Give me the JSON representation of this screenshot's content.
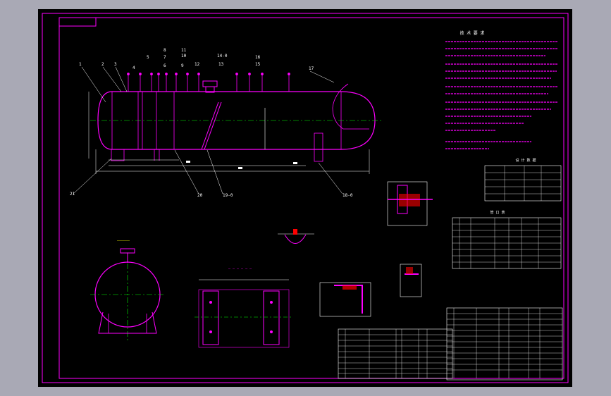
{
  "drawing": {
    "title_block_top_left": "",
    "part_numbers": [
      "1",
      "2",
      "3",
      "4",
      "5",
      "6",
      "7",
      "8",
      "9",
      "10",
      "11",
      "12",
      "13",
      "14-0",
      "15",
      "16",
      "17",
      "18-0",
      "19-0",
      "20",
      "21"
    ]
  },
  "notes": {
    "heading": "技 术 要 求"
  },
  "tables": {
    "design_data_title": "设 计 数 据",
    "nozzle_table_title": "管 口 表"
  },
  "colors": {
    "background": "#a9a9b5",
    "sheet": "#000000",
    "outline": "#ff00ff",
    "centerline": "#00ff00",
    "dimension": "#ffffff",
    "leader": "#ffff00",
    "hatch": "#ff0000"
  }
}
